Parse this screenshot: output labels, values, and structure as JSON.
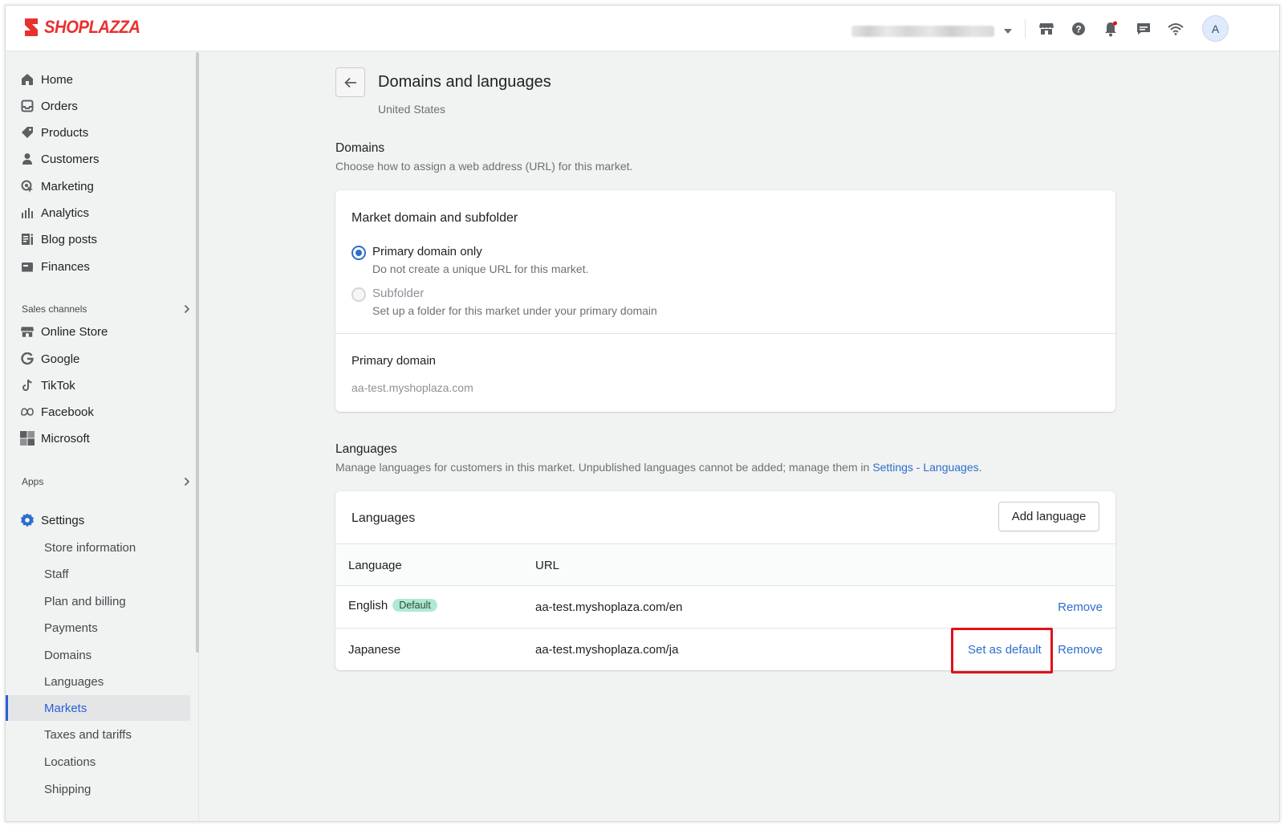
{
  "brand": {
    "name": "SHOPLAZZA",
    "color": "#e8302f"
  },
  "topbar": {
    "store_selector": "",
    "icons": [
      "store-icon",
      "help-icon",
      "bell-icon",
      "chat-icon",
      "wifi-icon"
    ],
    "avatar_initial": "A"
  },
  "sidebar": {
    "main_items": [
      {
        "label": "Home",
        "icon": "home-icon"
      },
      {
        "label": "Orders",
        "icon": "orders-icon"
      },
      {
        "label": "Products",
        "icon": "tag-icon"
      },
      {
        "label": "Customers",
        "icon": "person-icon"
      },
      {
        "label": "Marketing",
        "icon": "marketing-icon"
      },
      {
        "label": "Analytics",
        "icon": "analytics-icon"
      },
      {
        "label": "Blog posts",
        "icon": "blog-icon"
      },
      {
        "label": "Finances",
        "icon": "finances-icon"
      }
    ],
    "sales_channels_heading": "Sales channels",
    "channels": [
      {
        "label": "Online Store",
        "icon": "store-icon"
      },
      {
        "label": "Google",
        "icon": "google-icon"
      },
      {
        "label": "TikTok",
        "icon": "tiktok-icon"
      },
      {
        "label": "Facebook",
        "icon": "meta-icon"
      },
      {
        "label": "Microsoft",
        "icon": "microsoft-icon"
      }
    ],
    "apps_heading": "Apps",
    "settings_label": "Settings",
    "settings_items": [
      "Store information",
      "Staff",
      "Plan and billing",
      "Payments",
      "Domains",
      "Languages",
      "Markets",
      "Taxes and tariffs",
      "Locations",
      "Shipping"
    ],
    "active_item": "Markets"
  },
  "page": {
    "title": "Domains and languages",
    "subtitle": "United States"
  },
  "domains": {
    "title": "Domains",
    "description": "Choose how to assign a web address (URL) for this market.",
    "card_title": "Market domain and subfolder",
    "options": [
      {
        "label": "Primary domain only",
        "help": "Do not create a unique URL for this market.",
        "checked": true,
        "disabled": false
      },
      {
        "label": "Subfolder",
        "help": "Set up a folder for this market under your primary domain",
        "checked": false,
        "disabled": true
      }
    ],
    "primary_domain_label": "Primary domain",
    "primary_domain_value": "aa-test.myshoplaza.com"
  },
  "languages": {
    "title": "Languages",
    "description_prefix": "Manage languages for customers in this market. Unpublished languages cannot be added; manage them in ",
    "description_link": "Settings - Languages",
    "description_suffix": ".",
    "card_title": "Languages",
    "add_button": "Add language",
    "columns": [
      "Language",
      "URL"
    ],
    "rows": [
      {
        "language": "English",
        "badge": "Default",
        "url": "aa-test.myshoplaza.com/en",
        "set_default": "",
        "remove": "Remove"
      },
      {
        "language": "Japanese",
        "badge": "",
        "url": "aa-test.myshoplaza.com/ja",
        "set_default": "Set as default",
        "remove": "Remove"
      }
    ]
  },
  "colors": {
    "accent": "#2c6ecb",
    "highlight_box": "#e0101a",
    "badge_bg": "#aee9d1"
  }
}
